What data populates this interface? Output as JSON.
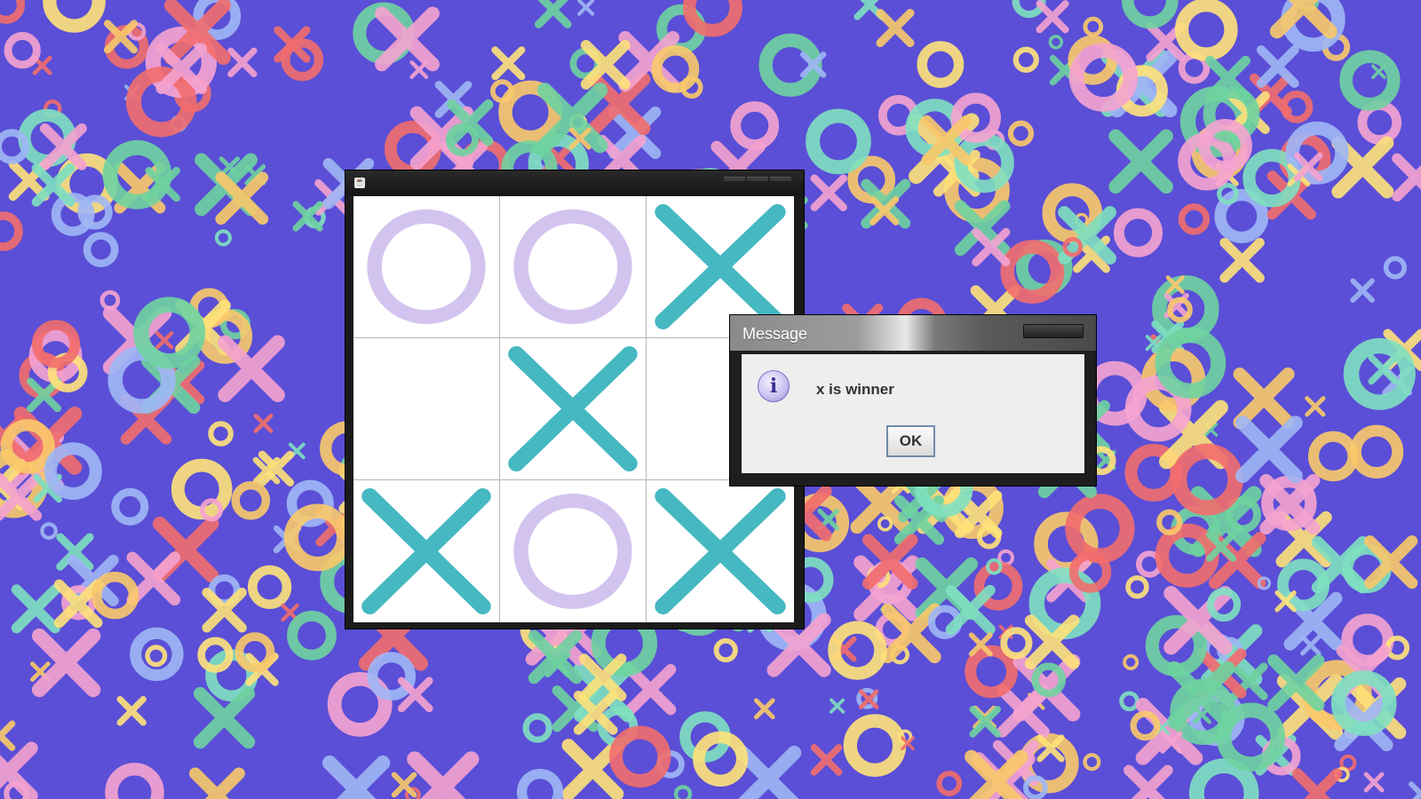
{
  "desktop": {
    "background_color": "#5a4fd6",
    "pattern_colors": [
      "#f26d6d",
      "#f9c96a",
      "#6fd3a0",
      "#9fb7f5",
      "#f5a3d0",
      "#7fe0c0",
      "#ffe27a"
    ]
  },
  "game_window": {
    "icon": "java-icon",
    "board": [
      [
        "O",
        "O",
        "X"
      ],
      [
        "",
        "X",
        ""
      ],
      [
        "X",
        "O",
        "X"
      ]
    ],
    "x_color": "#45b8c2",
    "o_color": "#d3c4ef"
  },
  "dialog": {
    "title": "Message",
    "icon": "info-icon",
    "message": "x is winner",
    "ok_label": "OK"
  }
}
